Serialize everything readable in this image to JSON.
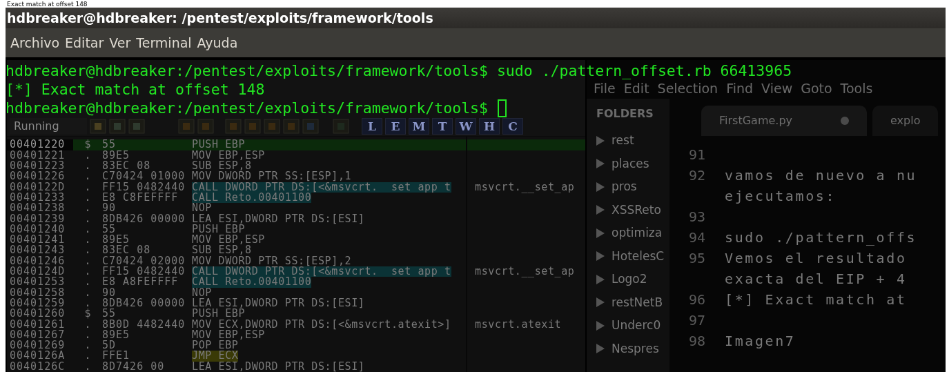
{
  "caption": "Exact match at offset 148",
  "terminal": {
    "title": "hdbreaker@hdbreaker: /pentest/exploits/framework/tools",
    "menu": [
      "Archivo",
      "Editar",
      "Ver",
      "Terminal",
      "Ayuda"
    ],
    "lines": [
      "hdbreaker@hdbreaker:/pentest/exploits/framework/tools$ sudo ./pattern_offset.rb 66413965",
      "[*] Exact match at offset 148",
      "hdbreaker@hdbreaker:/pentest/exploits/framework/tools$"
    ],
    "cursor": true
  },
  "debugger": {
    "status": "Running",
    "toolbar_letters": [
      "L",
      "E",
      "M",
      "T",
      "W",
      "H",
      "C"
    ],
    "rows": [
      {
        "address": "00401220",
        "marker": "$",
        "hex": "55",
        "instruction": "PUSH EBP",
        "kind": "plain",
        "selected": true
      },
      {
        "address": "00401221",
        "marker": ".",
        "hex": "89E5",
        "instruction": "MOV EBP,ESP",
        "kind": "plain",
        "selected": false
      },
      {
        "address": "00401223",
        "marker": ".",
        "hex": "83EC 08",
        "instruction": "SUB ESP,8",
        "kind": "plain",
        "selected": false
      },
      {
        "address": "00401226",
        "marker": ".",
        "hex": "C70424 01000",
        "instruction": "MOV DWORD PTR SS:[ESP],1",
        "kind": "plain",
        "selected": false
      },
      {
        "address": "0040122D",
        "marker": ".",
        "hex": "FF15 0482440",
        "instruction": "CALL DWORD PTR DS:[<&msvcrt.__set_app_t",
        "comment": "msvcrt.__set_ap",
        "kind": "call",
        "selected": false
      },
      {
        "address": "00401233",
        "marker": ".",
        "hex": "E8 C8FEFFFF",
        "instruction": "CALL Reto.00401100",
        "kind": "call",
        "selected": false
      },
      {
        "address": "00401238",
        "marker": ".",
        "hex": "90",
        "instruction": "NOP",
        "kind": "plain",
        "selected": false
      },
      {
        "address": "00401239",
        "marker": ".",
        "hex": "8DB426 00000",
        "instruction": "LEA ESI,DWORD PTR DS:[ESI]",
        "kind": "plain",
        "selected": false
      },
      {
        "address": "00401240",
        "marker": ".",
        "hex": "55",
        "instruction": "PUSH EBP",
        "kind": "plain",
        "selected": false
      },
      {
        "address": "00401241",
        "marker": ".",
        "hex": "89E5",
        "instruction": "MOV EBP,ESP",
        "kind": "plain",
        "selected": false
      },
      {
        "address": "00401243",
        "marker": ".",
        "hex": "83EC 08",
        "instruction": "SUB ESP,8",
        "kind": "plain",
        "selected": false
      },
      {
        "address": "00401246",
        "marker": ".",
        "hex": "C70424 02000",
        "instruction": "MOV DWORD PTR SS:[ESP],2",
        "kind": "plain",
        "selected": false
      },
      {
        "address": "0040124D",
        "marker": ".",
        "hex": "FF15 0482440",
        "instruction": "CALL DWORD PTR DS:[<&msvcrt.__set_app_t",
        "comment": "msvcrt.__set_ap",
        "kind": "call",
        "selected": false
      },
      {
        "address": "00401253",
        "marker": ".",
        "hex": "E8 A8FEFFFF",
        "instruction": "CALL Reto.00401100",
        "kind": "call",
        "selected": false
      },
      {
        "address": "00401258",
        "marker": ".",
        "hex": "90",
        "instruction": "NOP",
        "kind": "plain",
        "selected": false
      },
      {
        "address": "00401259",
        "marker": ".",
        "hex": "8DB426 00000",
        "instruction": "LEA ESI,DWORD PTR DS:[ESI]",
        "kind": "plain",
        "selected": false
      },
      {
        "address": "00401260",
        "marker": "$",
        "hex": "55",
        "instruction": "PUSH EBP",
        "kind": "plain",
        "selected": false
      },
      {
        "address": "00401261",
        "marker": ".",
        "hex": "8B0D 4482440",
        "instruction": "MOV ECX,DWORD PTR DS:[<&msvcrt.atexit>]",
        "comment": "msvcrt.atexit",
        "kind": "plain",
        "selected": false
      },
      {
        "address": "00401267",
        "marker": ".",
        "hex": "89E5",
        "instruction": "MOV EBP,ESP",
        "kind": "plain",
        "selected": false
      },
      {
        "address": "00401269",
        "marker": ".",
        "hex": "5D",
        "instruction": "POP EBP",
        "kind": "plain",
        "selected": false
      },
      {
        "address": "0040126A",
        "marker": ".",
        "hex": "FFE1",
        "instruction": "JMP ECX",
        "kind": "jump",
        "selected": false
      },
      {
        "address": "0040126C",
        "marker": ".",
        "hex": "8D7426 00",
        "instruction": "LEA ESI,DWORD PTR DS:[ESI]",
        "kind": "plain",
        "selected": false
      }
    ]
  },
  "editor": {
    "menu": [
      "File",
      "Edit",
      "Selection",
      "Find",
      "View",
      "Goto",
      "Tools"
    ],
    "sidebar_title": "FOLDERS",
    "folders": [
      "rest",
      "places",
      "pros",
      "XSSReto",
      "optimiza",
      "HotelesC",
      "Logo2",
      "restNetB",
      "Underc0",
      "Nespres"
    ],
    "tabs": [
      {
        "label": "FirstGame.py",
        "modified": true
      },
      {
        "label": "explo",
        "modified": false
      }
    ],
    "lines": [
      {
        "number": "91"
      },
      {
        "number": "92",
        "text": "vamos de nuevo a nu"
      },
      {
        "text": "ejecutamos:"
      },
      {
        "number": "93"
      },
      {
        "number": "94",
        "text": "sudo ./pattern_offs"
      },
      {
        "number": "95",
        "text": "Vemos el resultado"
      },
      {
        "text": "exacta del EIP + 4"
      },
      {
        "number": "96",
        "text": "[*] Exact match at"
      },
      {
        "number": "97"
      },
      {
        "number": "98",
        "text": "Imagen7"
      }
    ]
  }
}
